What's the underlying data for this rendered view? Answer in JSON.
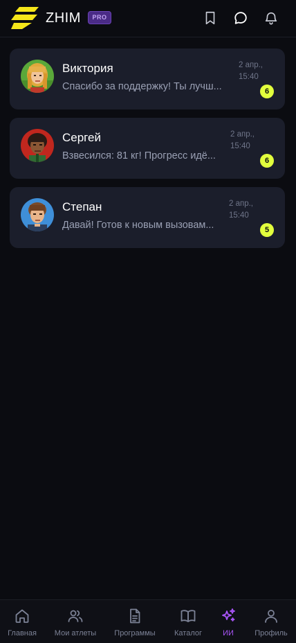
{
  "header": {
    "brand": "ZHIM",
    "pro_badge": "PRO",
    "icons": [
      "bookmark-icon",
      "chat-bubble-icon",
      "bell-icon"
    ]
  },
  "chats": [
    {
      "name": "Виктория",
      "preview": "Спасибо за поддержку! Ты лучш...",
      "date": "2 апр.,",
      "time": "15:40",
      "unread": "6"
    },
    {
      "name": "Сергей",
      "preview": "Взвесился: 81 кг! Прогресс идё...",
      "date": "2 апр.,",
      "time": "15:40",
      "unread": "6"
    },
    {
      "name": "Степан",
      "preview": "Давай! Готов к новым вызовам...",
      "date": "2 апр.,",
      "time": "15:40",
      "unread": "5"
    }
  ],
  "nav": {
    "items": [
      {
        "label": "Главная",
        "icon": "home-icon"
      },
      {
        "label": "Мои атлеты",
        "icon": "users-icon"
      },
      {
        "label": "Программы",
        "icon": "document-icon"
      },
      {
        "label": "Каталог",
        "icon": "book-icon"
      },
      {
        "label": "ИИ",
        "icon": "sparkles-icon"
      },
      {
        "label": "Профиль",
        "icon": "user-icon"
      }
    ],
    "active": "ИИ"
  },
  "colors": {
    "background": "#0b0c11",
    "card": "#1b1e2b",
    "accent_purple": "#a855f7",
    "badge_yellow": "#e2ff3d",
    "logo_yellow": "#f5e61a",
    "pro_badge_bg": "#4a2b86"
  }
}
